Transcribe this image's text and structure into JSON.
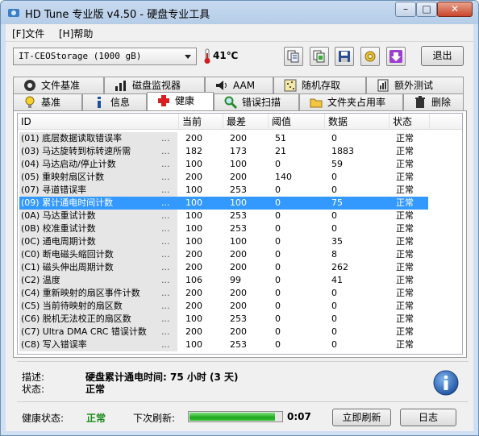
{
  "window": {
    "title": "HD Tune 专业版 v4.50 - 硬盘专业工具",
    "minimize_label": "–",
    "maximize_label": "□",
    "close_label": "✕"
  },
  "menu": [
    "[F]文件",
    "[H]帮助"
  ],
  "toolbar": {
    "drive": "IT-CEOStorage (1000 gB)",
    "temperature": "41℃",
    "buttons": [
      "copy-info-icon",
      "copy-screenshot-icon",
      "save-icon",
      "options-icon",
      "download-icon"
    ],
    "exit_label": "退出"
  },
  "tabs_top": [
    "文件基准",
    "磁盘监视器",
    "AAM",
    "随机存取",
    "额外测试"
  ],
  "tabs_bottom": [
    "基准",
    "信息",
    "健康",
    "错误扫描",
    "文件夹占用率",
    "删除"
  ],
  "active_tab": "健康",
  "columns": [
    "ID",
    "当前",
    "最差",
    "阈值",
    "数据",
    "状态"
  ],
  "rows": [
    {
      "id": "(01) 底层数据读取错误率",
      "current": "200",
      "worst": "200",
      "threshold": "51",
      "data": "0",
      "status": "正常"
    },
    {
      "id": "(03) 马达旋转到标转速所需",
      "current": "182",
      "worst": "173",
      "threshold": "21",
      "data": "1883",
      "status": "正常"
    },
    {
      "id": "(04) 马达启动/停止计数",
      "current": "100",
      "worst": "100",
      "threshold": "0",
      "data": "59",
      "status": "正常"
    },
    {
      "id": "(05) 重映射扇区计数",
      "current": "200",
      "worst": "200",
      "threshold": "140",
      "data": "0",
      "status": "正常"
    },
    {
      "id": "(07) 寻道错误率",
      "current": "100",
      "worst": "253",
      "threshold": "0",
      "data": "0",
      "status": "正常"
    },
    {
      "id": "(09) 累计通电时间计数",
      "current": "100",
      "worst": "100",
      "threshold": "0",
      "data": "75",
      "status": "正常"
    },
    {
      "id": "(0A) 马达重试计数",
      "current": "100",
      "worst": "253",
      "threshold": "0",
      "data": "0",
      "status": "正常"
    },
    {
      "id": "(0B) 校准重试计数",
      "current": "100",
      "worst": "253",
      "threshold": "0",
      "data": "0",
      "status": "正常"
    },
    {
      "id": "(0C) 通电周期计数",
      "current": "100",
      "worst": "100",
      "threshold": "0",
      "data": "35",
      "status": "正常"
    },
    {
      "id": "(C0) 断电磁头缩回计数",
      "current": "200",
      "worst": "200",
      "threshold": "0",
      "data": "8",
      "status": "正常"
    },
    {
      "id": "(C1) 磁头伸出周期计数",
      "current": "200",
      "worst": "200",
      "threshold": "0",
      "data": "262",
      "status": "正常"
    },
    {
      "id": "(C2) 温度",
      "current": "106",
      "worst": "99",
      "threshold": "0",
      "data": "41",
      "status": "正常"
    },
    {
      "id": "(C4) 重新映射的扇区事件计数",
      "current": "200",
      "worst": "200",
      "threshold": "0",
      "data": "0",
      "status": "正常"
    },
    {
      "id": "(C5) 当前待映射的扇区数",
      "current": "200",
      "worst": "200",
      "threshold": "0",
      "data": "0",
      "status": "正常"
    },
    {
      "id": "(C6) 脱机无法校正的扇区数",
      "current": "100",
      "worst": "253",
      "threshold": "0",
      "data": "0",
      "status": "正常"
    },
    {
      "id": "(C7) Ultra DMA CRC 错误计数",
      "current": "200",
      "worst": "200",
      "threshold": "0",
      "data": "0",
      "status": "正常"
    },
    {
      "id": "(C8) 写入错误率",
      "current": "100",
      "worst": "253",
      "threshold": "0",
      "data": "0",
      "status": "正常"
    }
  ],
  "selected_row": 5,
  "dots": "...",
  "detail": {
    "desc_label": "描述:",
    "desc_value": "硬盘累计通电时间: 75 小时 (3 天)",
    "status_label": "状态:",
    "status_value": "正常"
  },
  "footer": {
    "health_label": "健康状态:",
    "health_value": "正常",
    "next_refresh_label": "下次刷新:",
    "refresh_progress": 0.93,
    "timer": "0:07",
    "refresh_button": "立即刷新",
    "log_button": "日志"
  }
}
